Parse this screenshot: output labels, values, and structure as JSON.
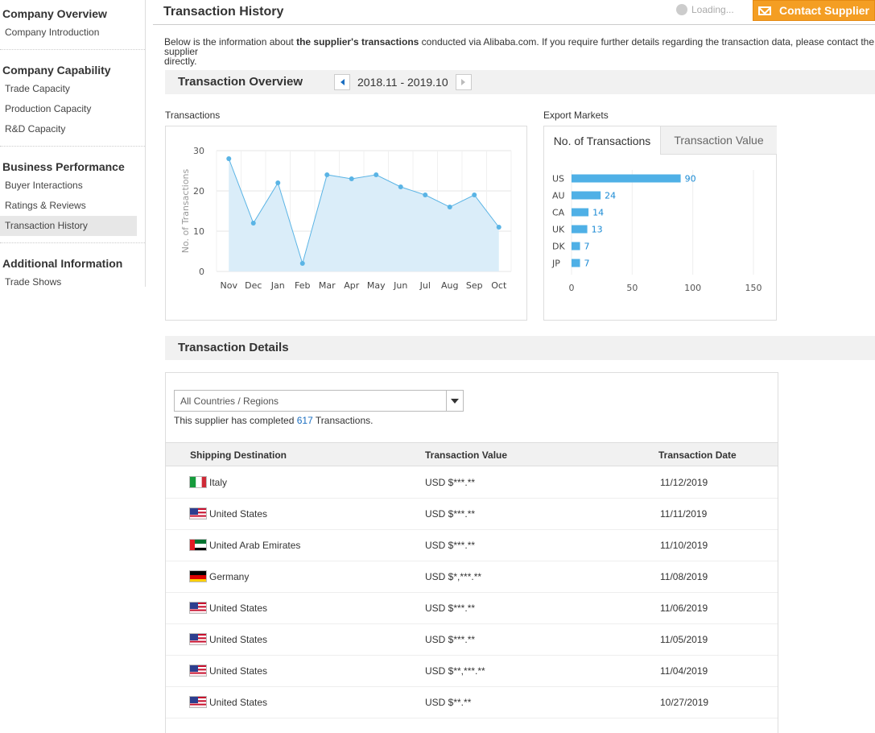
{
  "sidebar": {
    "groups": [
      {
        "title": "Company Overview",
        "items": [
          "Company Introduction"
        ]
      },
      {
        "title": "Company Capability",
        "items": [
          "Trade Capacity",
          "Production Capacity",
          "R&D Capacity"
        ]
      },
      {
        "title": "Business Performance",
        "items": [
          "Buyer Interactions",
          "Ratings & Reviews",
          "Transaction History"
        ]
      },
      {
        "title": "Additional Information",
        "items": [
          "Trade Shows"
        ]
      }
    ],
    "active_item": "Transaction History"
  },
  "header": {
    "title": "Transaction History",
    "loading_text": "Loading...",
    "contact_label": "Contact Supplier"
  },
  "intro": {
    "before": "Below is the information about ",
    "bold": "the supplier's transactions",
    "after": " conducted via Alibaba.com. If you require further details regarding the transaction data, please contact the supplier",
    "line2": "directly."
  },
  "overview": {
    "title": "Transaction Overview",
    "period": "2018.11 - 2019.10",
    "transactions_label": "Transactions",
    "export_label": "Export Markets",
    "tabs": [
      "No. of Transactions",
      "Transaction Value"
    ],
    "active_tab": 0
  },
  "chart_data": [
    {
      "type": "area",
      "ylabel": "No. of Transactions",
      "categories": [
        "Nov",
        "Dec",
        "Jan",
        "Feb",
        "Mar",
        "Apr",
        "May",
        "Jun",
        "Jul",
        "Aug",
        "Sep",
        "Oct"
      ],
      "values": [
        28,
        12,
        22,
        2,
        24,
        23,
        24,
        21,
        19,
        16,
        19,
        11
      ],
      "ylim": [
        0,
        30
      ],
      "yticks": [
        0,
        10,
        20,
        30
      ],
      "grid": true,
      "color": "#5ab4e5",
      "fill": "#daedf9"
    },
    {
      "type": "bar",
      "orientation": "horizontal",
      "categories": [
        "US",
        "AU",
        "CA",
        "UK",
        "DK",
        "JP"
      ],
      "values": [
        90,
        24,
        14,
        13,
        7,
        7
      ],
      "xlim": [
        0,
        150
      ],
      "xticks": [
        0,
        50,
        100,
        150
      ],
      "color": "#4fb0e6",
      "label_color": "#1a8ad4"
    }
  ],
  "details": {
    "title": "Transaction Details",
    "select_value": "All Countries / Regions",
    "count_before": "This supplier has completed ",
    "count": "617",
    "count_after": " Transactions.",
    "columns": [
      "Shipping Destination",
      "Transaction Value",
      "Transaction Date"
    ],
    "rows": [
      {
        "country": "Italy",
        "flag": "it",
        "value": "USD $***.**",
        "date": "11/12/2019"
      },
      {
        "country": "United States",
        "flag": "us",
        "value": "USD $***.**",
        "date": "11/11/2019"
      },
      {
        "country": "United Arab Emirates",
        "flag": "ae",
        "value": "USD $***.**",
        "date": "11/10/2019"
      },
      {
        "country": "Germany",
        "flag": "de",
        "value": "USD $*,***.**",
        "date": "11/08/2019"
      },
      {
        "country": "United States",
        "flag": "us",
        "value": "USD $***.**",
        "date": "11/06/2019"
      },
      {
        "country": "United States",
        "flag": "us",
        "value": "USD $***.**",
        "date": "11/05/2019"
      },
      {
        "country": "United States",
        "flag": "us",
        "value": "USD $**,***.**",
        "date": "11/04/2019"
      },
      {
        "country": "United States",
        "flag": "us",
        "value": "USD $**.**",
        "date": "10/27/2019"
      }
    ]
  }
}
